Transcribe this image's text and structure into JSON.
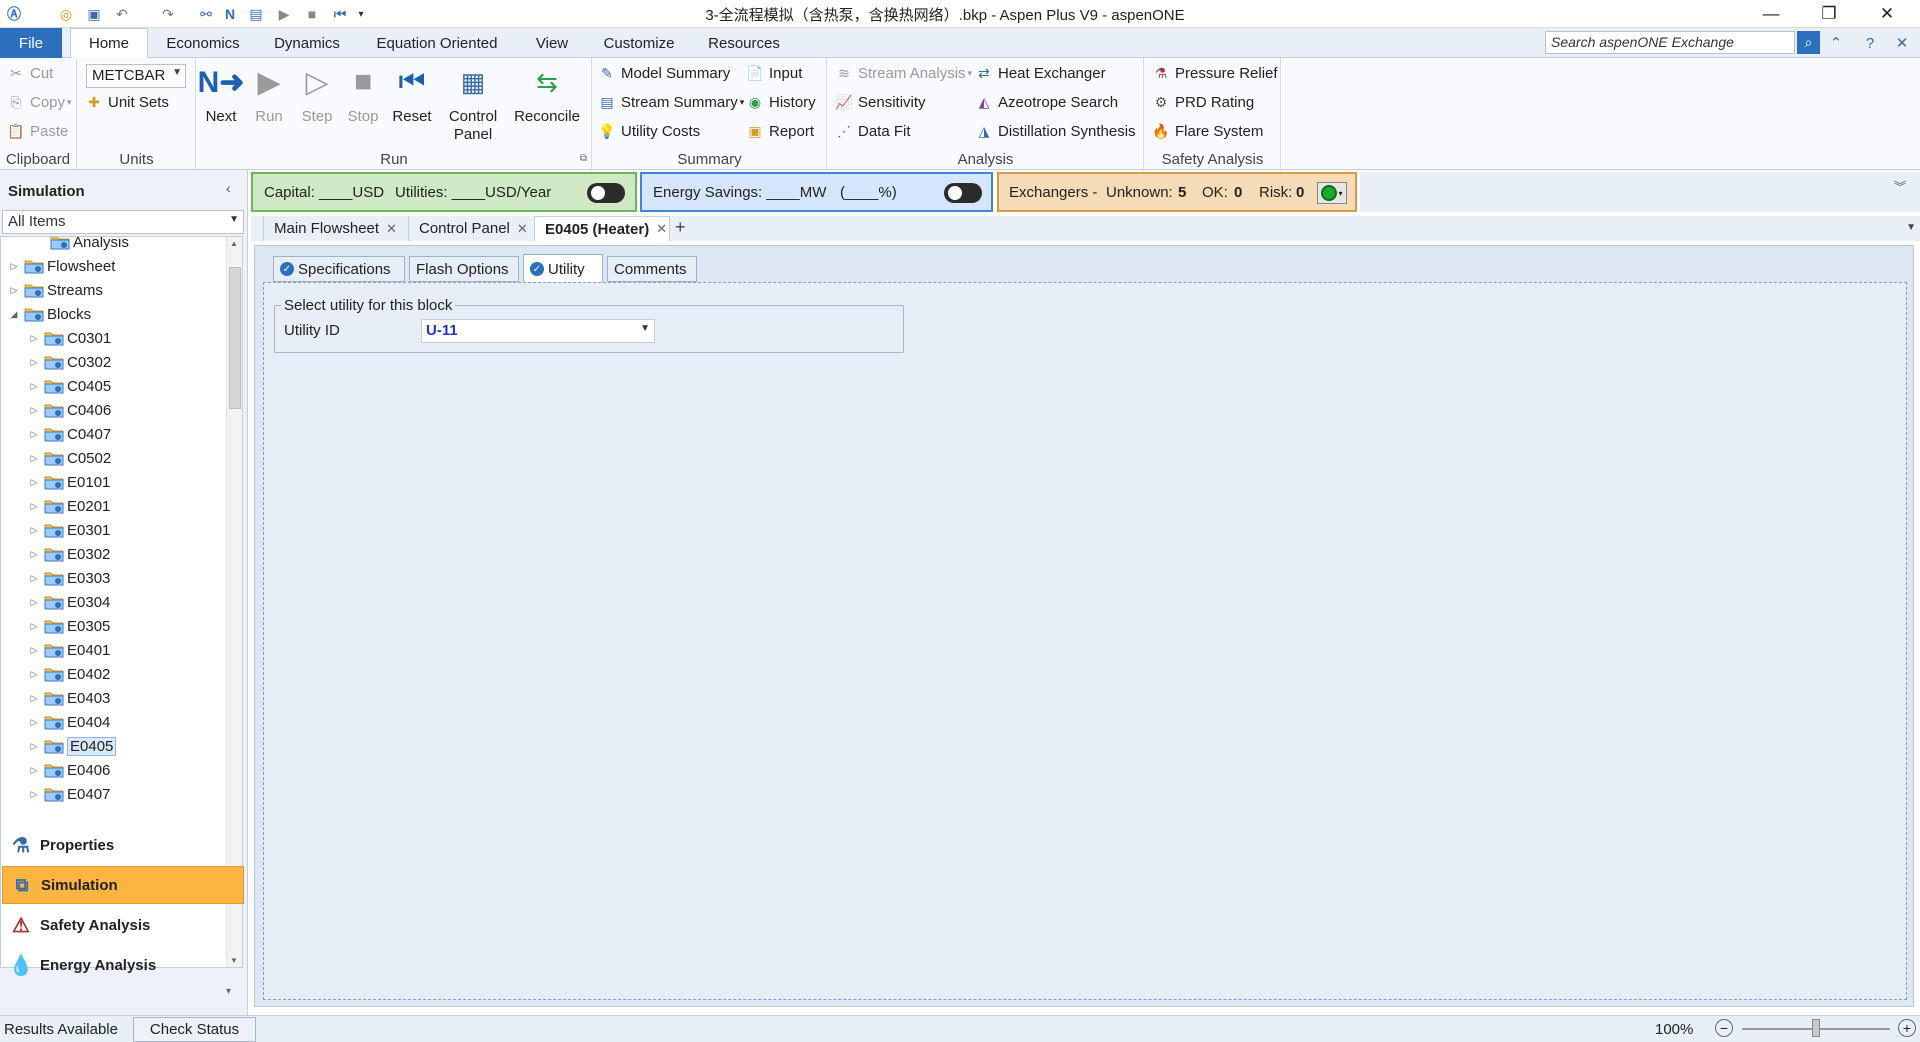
{
  "window": {
    "title": "3-全流程模拟（含热泵，含换热网络）.bkp - Aspen Plus V9 - aspenONE"
  },
  "menu": {
    "tabs": [
      "File",
      "Home",
      "Economics",
      "Dynamics",
      "Equation Oriented",
      "View",
      "Customize",
      "Resources"
    ],
    "active": "Home",
    "search_placeholder": "Search aspenONE Exchange"
  },
  "ribbon": {
    "clipboard": {
      "label": "Clipboard",
      "cut": "Cut",
      "copy": "Copy",
      "paste": "Paste"
    },
    "units": {
      "label": "Units",
      "unit_set_value": "METCBAR",
      "unit_sets": "Unit Sets"
    },
    "run": {
      "label": "Run",
      "next": "Next",
      "run": "Run",
      "step": "Step",
      "stop": "Stop",
      "reset": "Reset",
      "control_panel": "Control Panel",
      "reconcile": "Reconcile"
    },
    "summary": {
      "label": "Summary",
      "model_summary": "Model Summary",
      "stream_summary": "Stream Summary",
      "utility_costs": "Utility Costs",
      "input": "Input",
      "history": "History",
      "report": "Report"
    },
    "analysis": {
      "label": "Analysis",
      "stream_analysis": "Stream Analysis",
      "sensitivity": "Sensitivity",
      "data_fit": "Data Fit",
      "heat_exchanger": "Heat Exchanger",
      "azeotrope_search": "Azeotrope Search",
      "distillation_synthesis": "Distillation Synthesis"
    },
    "safety": {
      "label": "Safety Analysis",
      "pressure_relief": "Pressure Relief",
      "prd_rating": "PRD Rating",
      "flare_system": "Flare System"
    }
  },
  "navigator": {
    "title": "Simulation",
    "filter": "All Items",
    "tree": [
      {
        "label": "Analysis",
        "level": 1
      },
      {
        "label": "Flowsheet",
        "level": 0
      },
      {
        "label": "Streams",
        "level": 0
      },
      {
        "label": "Blocks",
        "level": 0,
        "expanded": true
      },
      {
        "label": "C0301",
        "level": 1
      },
      {
        "label": "C0302",
        "level": 1
      },
      {
        "label": "C0405",
        "level": 1
      },
      {
        "label": "C0406",
        "level": 1
      },
      {
        "label": "C0407",
        "level": 1
      },
      {
        "label": "C0502",
        "level": 1
      },
      {
        "label": "E0101",
        "level": 1
      },
      {
        "label": "E0201",
        "level": 1
      },
      {
        "label": "E0301",
        "level": 1
      },
      {
        "label": "E0302",
        "level": 1
      },
      {
        "label": "E0303",
        "level": 1
      },
      {
        "label": "E0304",
        "level": 1
      },
      {
        "label": "E0305",
        "level": 1
      },
      {
        "label": "E0401",
        "level": 1
      },
      {
        "label": "E0402",
        "level": 1
      },
      {
        "label": "E0403",
        "level": 1
      },
      {
        "label": "E0404",
        "level": 1
      },
      {
        "label": "E0405",
        "level": 1,
        "selected": true
      },
      {
        "label": "E0406",
        "level": 1
      },
      {
        "label": "E0407",
        "level": 1
      }
    ],
    "sections": [
      "Properties",
      "Simulation",
      "Safety Analysis",
      "Energy Analysis"
    ],
    "active_section": "Simulation"
  },
  "strip": {
    "capital": "Capital: ____USD",
    "utilities": "Utilities: ____USD/Year",
    "energy_savings": "Energy Savings: ____MW",
    "energy_pct": "(____%)",
    "exchangers": "Exchangers -",
    "unknown_label": "Unknown:",
    "unknown_value": "5",
    "ok_label": "OK:",
    "ok_value": "0",
    "risk_label": "Risk:",
    "risk_value": "0"
  },
  "doc_tabs": [
    "Main Flowsheet",
    "Control Panel",
    "E0405 (Heater)"
  ],
  "active_doc_tab": "E0405 (Heater)",
  "form": {
    "sub_tabs": [
      "Specifications",
      "Flash Options",
      "Utility",
      "Comments"
    ],
    "active_sub_tab": "Utility",
    "group_title": "Select utility for this block",
    "utility_id_label": "Utility ID",
    "utility_id_value": "U-11"
  },
  "status": {
    "results": "Results Available",
    "check_status": "Check Status",
    "zoom": "100%",
    "zoom_level": 0.5
  },
  "colors": {
    "file_tab": "#2c6fbf",
    "nav_active": "#fbb540",
    "capital_bg": "#cfe9c4",
    "energy_bg": "#d5e6fb",
    "exchangers_bg": "#f6dcb6",
    "utility_value": "#1f34c8"
  }
}
